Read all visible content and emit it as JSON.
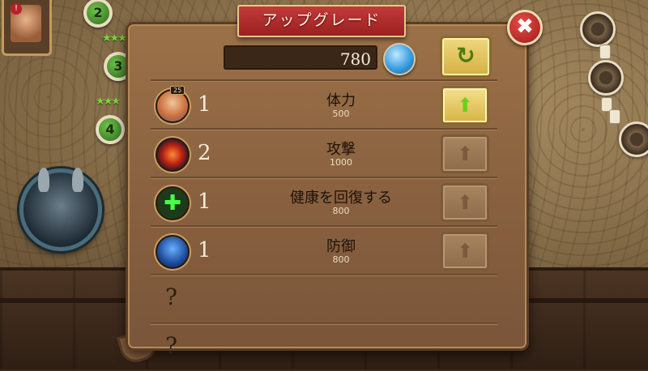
{
  "dialog": {
    "title": "アップグレード",
    "close_label": "✖",
    "currency": {
      "amount": "780",
      "icon": "gem-icon"
    },
    "refresh_label": "↻",
    "upgrades": [
      {
        "level": "1",
        "name": "体力",
        "cost": "500",
        "icon": "heroine-portrait-icon",
        "icon_badge": "25",
        "button_state": "active"
      },
      {
        "level": "2",
        "name": "攻撃",
        "cost": "1000",
        "icon": "fire-slash-icon",
        "button_state": "disabled"
      },
      {
        "level": "1",
        "name": "健康を回復する",
        "cost": "800",
        "icon": "green-cross-icon",
        "button_state": "disabled"
      },
      {
        "level": "1",
        "name": "防御",
        "cost": "800",
        "icon": "shield-icon",
        "button_state": "disabled"
      }
    ],
    "locked_slots": [
      {
        "label": "?"
      },
      {
        "label": "?"
      }
    ],
    "upgrade_arrow": "⬆"
  },
  "map": {
    "level_nodes": [
      {
        "label": "2"
      },
      {
        "label": "3"
      },
      {
        "label": "4"
      }
    ],
    "stars": "★★★",
    "alert_badge": "!"
  },
  "colors": {
    "panel": "#8a6240",
    "banner": "#b02a2a",
    "active_button": "#e6c864",
    "arrow_active": "#6fd01a"
  }
}
